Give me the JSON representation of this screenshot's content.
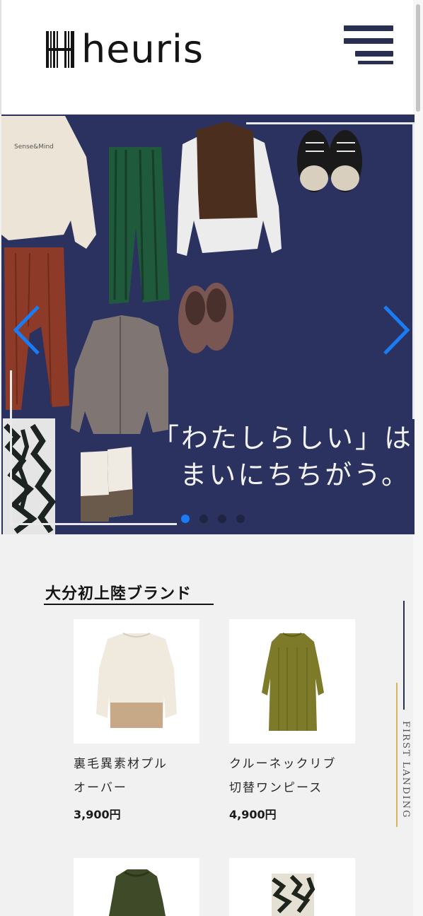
{
  "header": {
    "logo_text": "heuris",
    "menu_icon": "hamburger-menu-icon"
  },
  "hero": {
    "catchcopy_line1": "「わたしらしい」は",
    "catchcopy_line2": "まいにちちがう。",
    "prev_icon": "chevron-left-icon",
    "next_icon": "chevron-right-icon",
    "slide_count": 4,
    "active_slide": 1,
    "background_color": "#2c3260",
    "arrow_color": "#1a7cf5"
  },
  "section": {
    "title": "大分初上陸ブランド",
    "side_label": "FIRST LANDING"
  },
  "products": [
    {
      "name_line1": "裏毛異素材プル",
      "name_line2": "オーバー",
      "price": "3,900円"
    },
    {
      "name_line1": "クルーネックリブ",
      "name_line2": "切替ワンピース",
      "price": "4,900円"
    }
  ]
}
